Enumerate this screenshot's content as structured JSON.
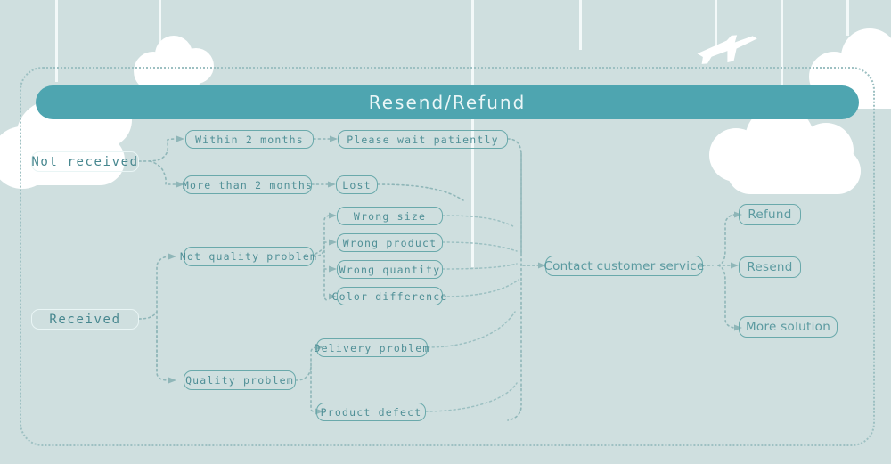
{
  "page": {
    "title": "Resend/Refund",
    "background_color": "#cfdfdf",
    "banner_color": "#4ea5b0",
    "node_border_color": "#6aa9ab",
    "node_text_color": "#4f8f96",
    "connector_color": "#8fb6b8",
    "frame_border_color": "#9dc0c2"
  },
  "banner": {
    "title": "Resend/Refund"
  },
  "flow": {
    "roots": [
      {
        "id": "not-received",
        "label": "Not received"
      },
      {
        "id": "received",
        "label": "Received"
      }
    ],
    "not_received_branch": [
      {
        "id": "within-2-months",
        "label": "Within 2 months",
        "result": {
          "id": "please-wait-patiently",
          "label": "Please wait patiently"
        }
      },
      {
        "id": "more-than-2-months",
        "label": "More than 2 months",
        "result": {
          "id": "lost",
          "label": "Lost"
        }
      }
    ],
    "received_branch": [
      {
        "id": "not-quality-problem",
        "label": "Not quality problem",
        "children": [
          {
            "id": "wrong-size",
            "label": "Wrong size"
          },
          {
            "id": "wrong-product",
            "label": "Wrong product"
          },
          {
            "id": "wrong-quantity",
            "label": "Wrong quantity"
          },
          {
            "id": "color-difference",
            "label": "Color difference"
          }
        ]
      },
      {
        "id": "quality-problem",
        "label": "Quality problem",
        "children": [
          {
            "id": "delivery-problem",
            "label": "Delivery problem"
          },
          {
            "id": "product-defect",
            "label": "Product defect"
          }
        ]
      }
    ],
    "contact": {
      "id": "contact-customer-service",
      "label": "Contact customer service"
    },
    "solutions": [
      {
        "id": "refund",
        "label": "Refund"
      },
      {
        "id": "resend",
        "label": "Resend"
      },
      {
        "id": "more-solution",
        "label": "More solution"
      }
    ]
  },
  "decor": {
    "airplane": "airplane-icon",
    "clouds": "cloud-decoration",
    "strings": "hanging-string-decoration"
  }
}
